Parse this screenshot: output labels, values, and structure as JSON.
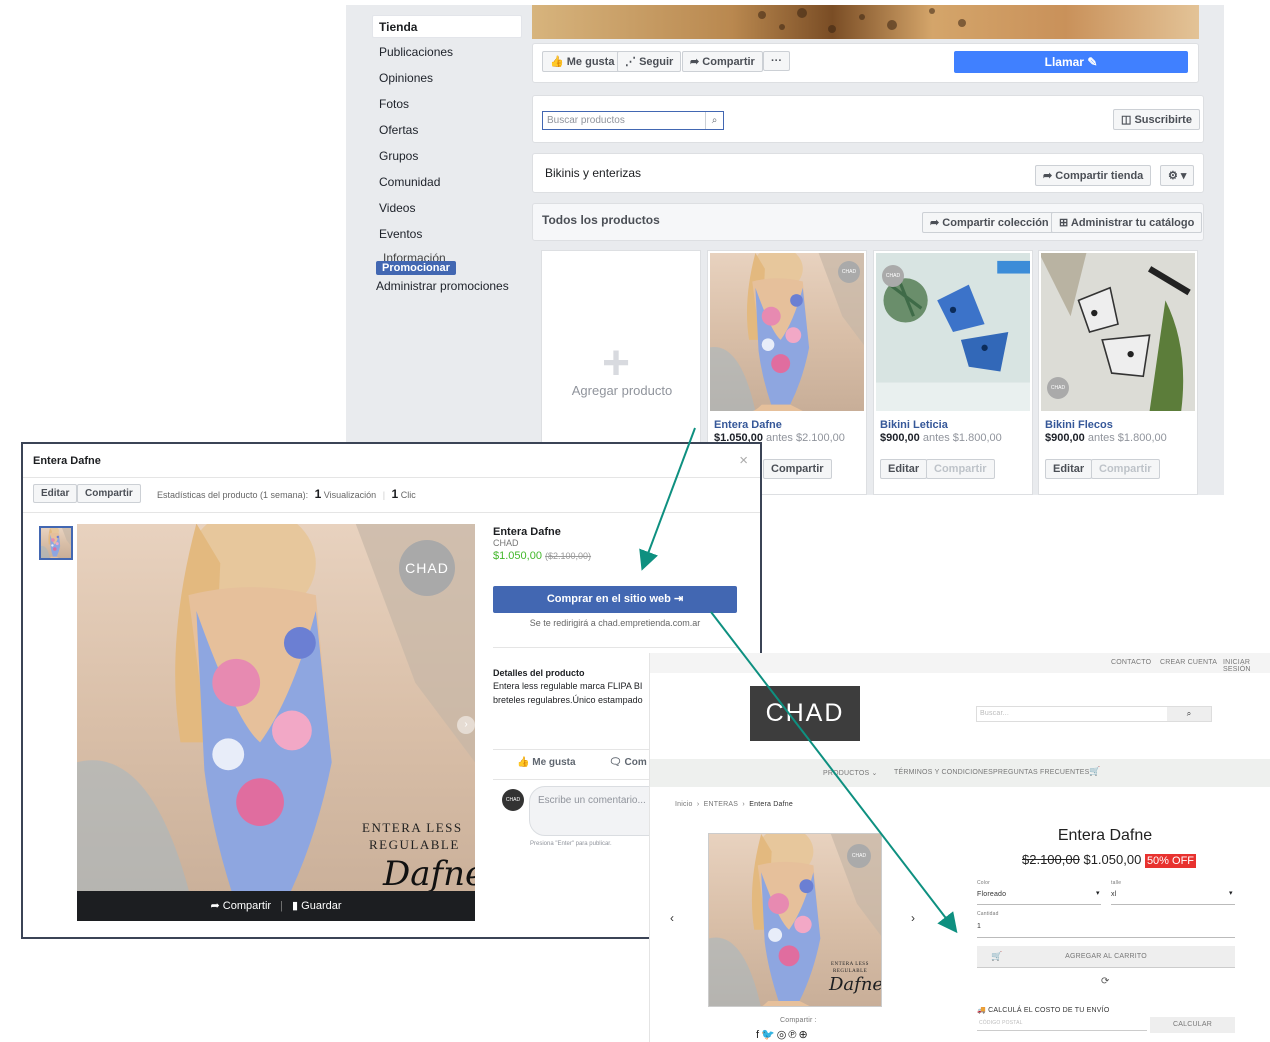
{
  "fb_page": {
    "sidebar": {
      "active": "Tienda",
      "items": [
        "Publicaciones",
        "Opiniones",
        "Fotos",
        "Ofertas",
        "Grupos",
        "Comunidad",
        "Videos",
        "Eventos",
        "Información"
      ],
      "promote": "Promocionar",
      "manage_promotions": "Administrar promociones"
    },
    "actions": {
      "like": "Me gusta",
      "follow": "Seguir",
      "share": "Compartir",
      "more": "···",
      "call": "Llamar"
    },
    "search_placeholder": "Buscar productos",
    "subscribe": "Suscribirte",
    "shop_title": "Bikinis y enterizas",
    "share_shop": "Compartir tienda",
    "all_products": "Todos los productos",
    "share_collection": "Compartir colección",
    "manage_catalog": "Administrar tu catálogo",
    "add_product": "Agregar producto",
    "products": [
      {
        "name": "Entera Dafne",
        "price": "$1.050,00",
        "before": "antes $2.100,00",
        "edit": "Editar",
        "share": "Compartir"
      },
      {
        "name": "Bikini Leticia",
        "price": "$900,00",
        "before": "antes $1.800,00",
        "edit": "Editar",
        "share": "Compartir"
      },
      {
        "name": "Bikini Flecos",
        "price": "$900,00",
        "before": "antes $1.800,00",
        "edit": "Editar",
        "share": "Compartir"
      }
    ],
    "brand_badge": "CHAD"
  },
  "modal": {
    "title": "Entera Dafne",
    "edit": "Editar",
    "share": "Compartir",
    "stats_label": "Estadísticas del producto (1 semana):",
    "views_count": "1",
    "views_label": "Visualización",
    "clicks_count": "1",
    "clicks_label": "Clic",
    "product_name": "Entera Dafne",
    "brand": "CHAD",
    "price": "$1.050,00",
    "old_price": "($2.100,00)",
    "buy_button": "Comprar en el sitio web",
    "redirect_note": "Se te redirigirá a chad.empretienda.com.ar",
    "details_title": "Detalles del producto",
    "details_line1": "Entera less regulable marca FLIPA BI",
    "details_line2": "breteles regulabres.Único estampado",
    "like": "Me gusta",
    "comment": "Com",
    "comment_placeholder": "Escribe un comentario...",
    "enter_hint": "Presiona \"Enter\" para publicar.",
    "avatar_text": "CHAD",
    "photo_share": "Compartir",
    "photo_save": "Guardar",
    "photo_badge": "CHAD",
    "photo_caption_1": "ENTERA LESS",
    "photo_caption_2": "REGULABLE",
    "photo_script": "Dafne",
    "close": "×"
  },
  "store": {
    "top_links": [
      "CONTACTO",
      "CREAR CUENTA",
      "INICIAR SESIÓN"
    ],
    "logo": "CHAD",
    "search_placeholder": "Buscar...",
    "nav": [
      "PRODUCTOS",
      "TÉRMINOS Y CONDICIONES",
      "PREGUNTAS FRECUENTES"
    ],
    "breadcrumb": [
      "Inicio",
      "ENTERAS",
      "Entera Dafne"
    ],
    "product_title": "Entera Dafne",
    "old_price": "$2.100,00",
    "price": "$1.050,00",
    "discount": "50% OFF",
    "color_label": "Color",
    "color_value": "Floreado",
    "size_label": "talle",
    "size_value": "xl",
    "qty_label": "Cantidad",
    "qty_value": "1",
    "add_to_cart": "AGREGAR AL CARRITO",
    "shipping_label": "CALCULÁ EL COSTO DE TU ENVÍO",
    "postal_placeholder": "CÓDIGO POSTAL",
    "calc_button": "CALCULAR",
    "share_label": "Compartir",
    "image_badge": "CHAD",
    "image_caption_1": "ENTERA LESS",
    "image_caption_2": "REGULABLE",
    "image_script": "Dafne"
  },
  "colors": {
    "fb_blue": "#4267b2",
    "call_blue": "#4080ff",
    "price_green": "#42b72a",
    "arrow_teal": "#0e9080",
    "discount_red": "#e8322f"
  }
}
